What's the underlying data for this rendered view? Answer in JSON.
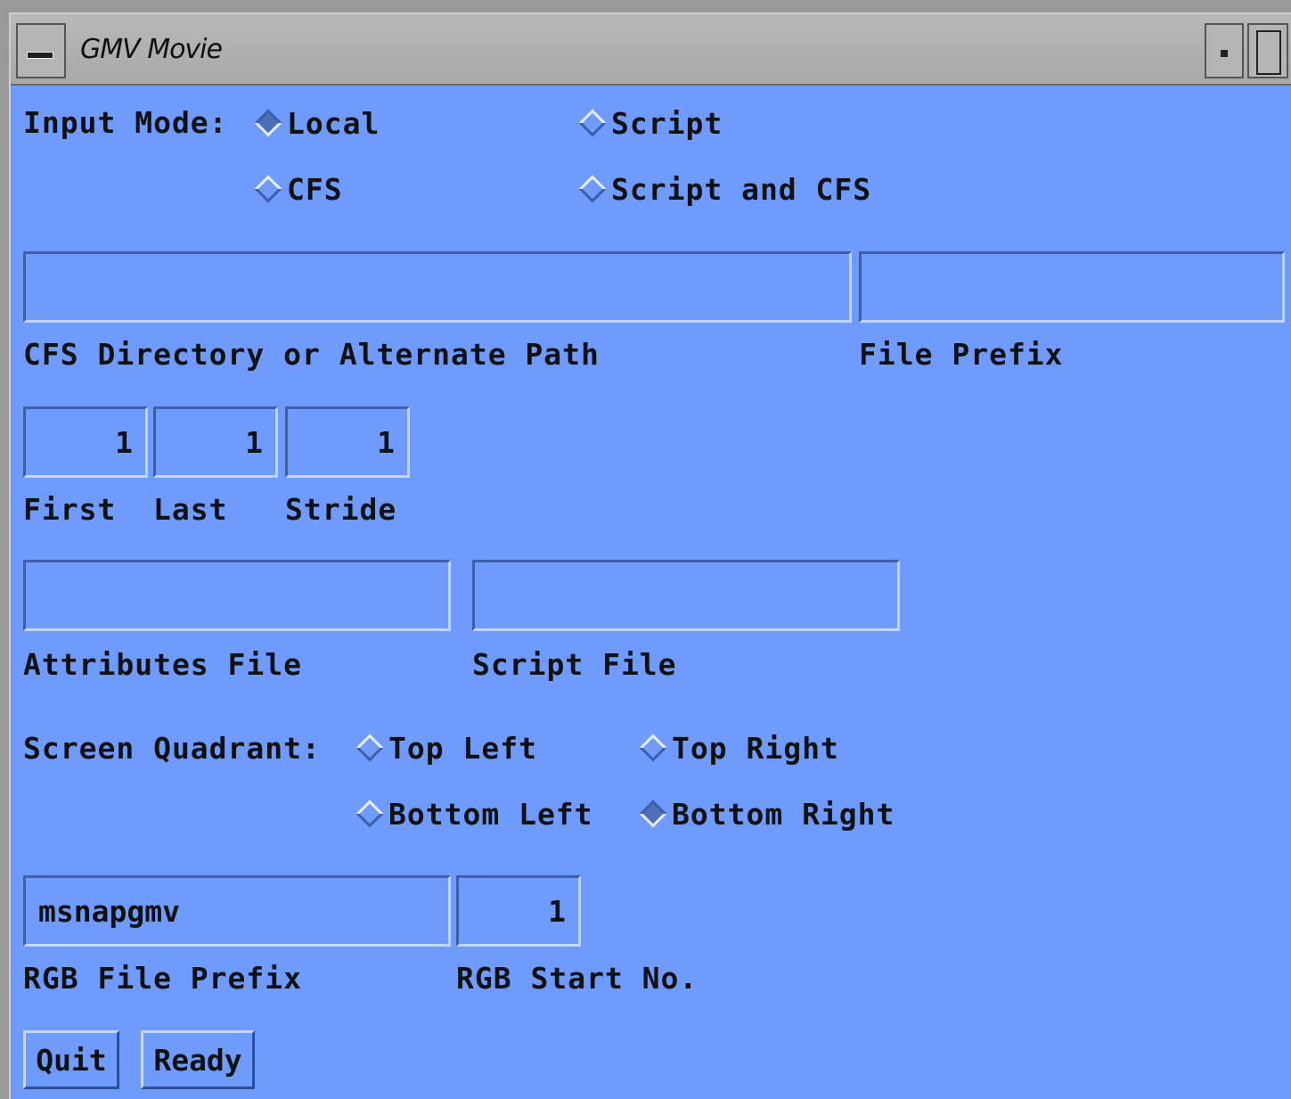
{
  "window": {
    "title": "GMV Movie"
  },
  "input_mode": {
    "label": "Input Mode:",
    "options": [
      "Local",
      "Script",
      "CFS",
      "Script and CFS"
    ],
    "selected": "Local"
  },
  "cfs_path": {
    "value": "",
    "label": "CFS Directory or Alternate Path"
  },
  "file_prefix": {
    "value": "",
    "label": "File Prefix"
  },
  "range": {
    "first": "1",
    "last": "1",
    "stride": "1",
    "first_label": "First",
    "last_label": "Last",
    "stride_label": "Stride"
  },
  "attributes_file": {
    "value": "",
    "label": "Attributes File"
  },
  "script_file": {
    "value": "",
    "label": "Script File"
  },
  "screen_quadrant": {
    "label": "Screen Quadrant:",
    "options": [
      "Top Left",
      "Top Right",
      "Bottom Left",
      "Bottom Right"
    ],
    "selected": "Bottom Right"
  },
  "rgb_file_prefix": {
    "value": "msnapgmv",
    "label": "RGB File Prefix"
  },
  "rgb_start_no": {
    "value": "1",
    "label": "RGB Start No."
  },
  "buttons": {
    "quit": "Quit",
    "ready": "Ready"
  }
}
